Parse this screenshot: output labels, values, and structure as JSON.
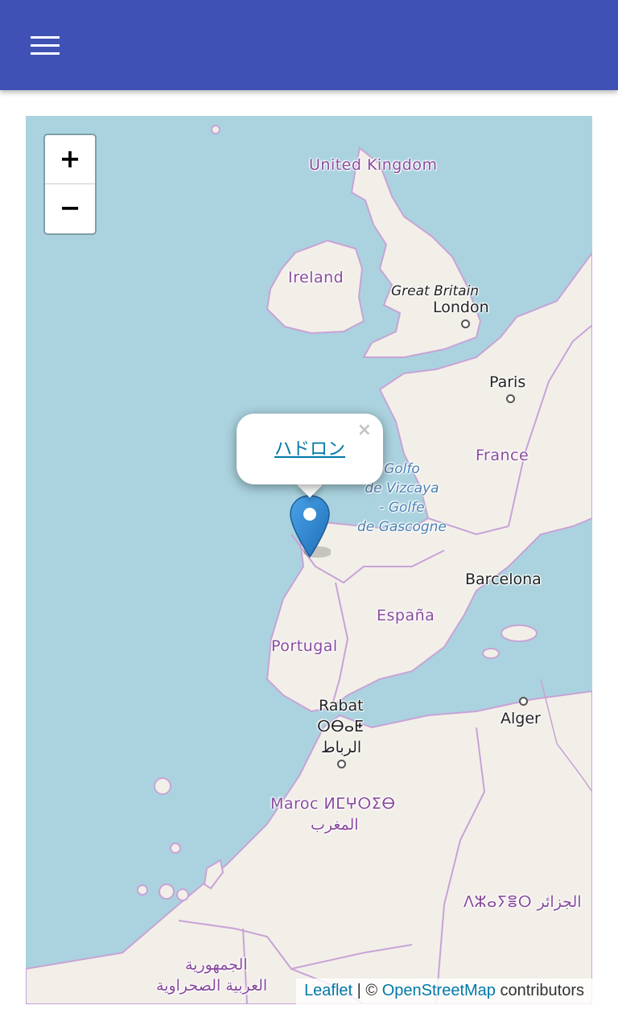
{
  "appbar": {
    "background": "#3f51b5",
    "menu_icon": "hamburger-menu-icon"
  },
  "map": {
    "zoom_in_label": "+",
    "zoom_out_label": "−",
    "labels": {
      "united_kingdom": "United Kingdom",
      "ireland": "Ireland",
      "great_britain": "Great Britain",
      "london": "London",
      "paris": "Paris",
      "france": "France",
      "sea_line1": "Golfo",
      "sea_line2": "de Vizcaya",
      "sea_line3": "- Golfe",
      "sea_line4": "de Gascogne",
      "barcelona": "Barcelona",
      "espana": "España",
      "portugal": "Portugal",
      "rabat": "Rabat",
      "rabat_tifinagh": "ⵔⴱⴰⵟ",
      "rabat_arabic": "الرباط",
      "alger": "Alger",
      "maroc": "Maroc ⵍⵎⵖⵔⵉⴱ",
      "maroc_arabic": "المغرب",
      "algeria": "ⴷⵣⴰⵢⴻⵔ الجزائر",
      "western_sahara_1": "الجمهورية",
      "western_sahara_2": "العربية الصحراوية"
    },
    "popup": {
      "link_text": "ハドロン",
      "close_label": "×"
    },
    "attribution": {
      "leaflet": "Leaflet",
      "separator": " | © ",
      "osm": "OpenStreetMap",
      "suffix": " contributors"
    },
    "colors": {
      "water": "#aad3df",
      "land": "#f2efe9",
      "border": "#c8a3d6",
      "link": "#0078a8",
      "marker": "#2a81cb"
    }
  }
}
